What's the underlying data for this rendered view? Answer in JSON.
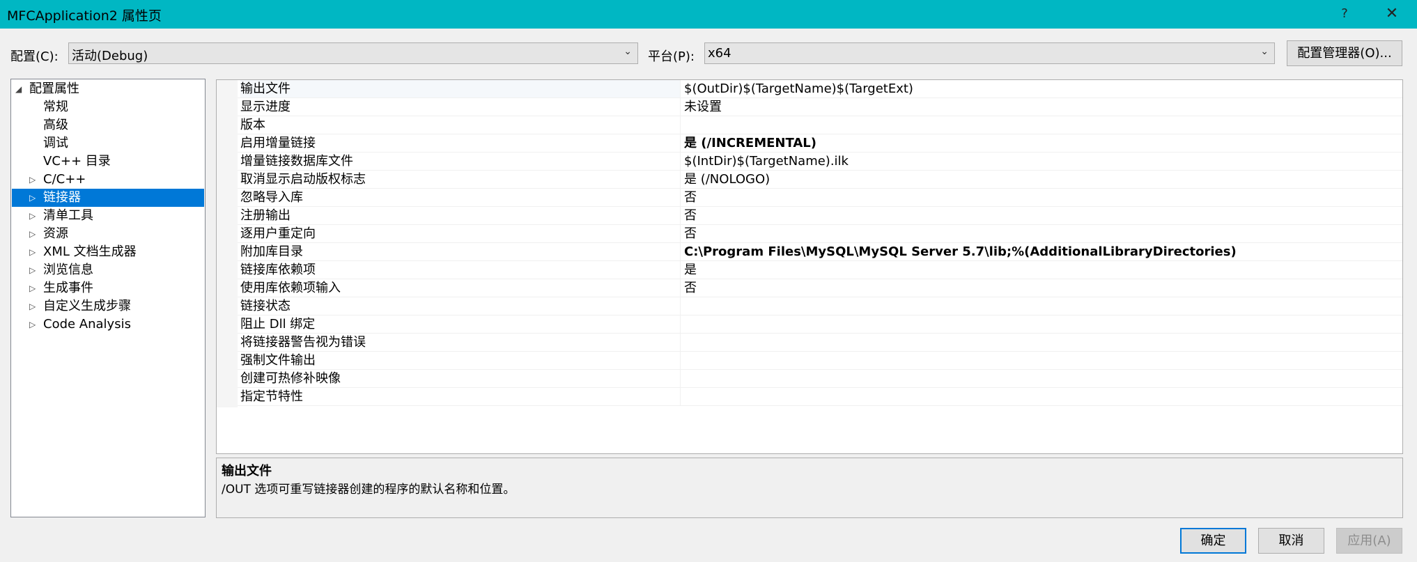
{
  "window": {
    "title": "MFCApplication2 属性页",
    "help_label": "?",
    "close_label": "✕"
  },
  "config_bar": {
    "config_label": "配置(C):",
    "config_value": "活动(Debug)",
    "platform_label": "平台(P):",
    "platform_value": "x64",
    "config_manager_label": "配置管理器(O)..."
  },
  "tree": {
    "items": [
      {
        "label": "配置属性",
        "twisty": "◢"
      },
      {
        "label": "常规",
        "twisty": ""
      },
      {
        "label": "高级",
        "twisty": ""
      },
      {
        "label": "调试",
        "twisty": ""
      },
      {
        "label": "VC++ 目录",
        "twisty": ""
      },
      {
        "label": "C/C++",
        "twisty": "▷"
      },
      {
        "label": "链接器",
        "twisty": "▷"
      },
      {
        "label": "清单工具",
        "twisty": "▷"
      },
      {
        "label": "资源",
        "twisty": "▷"
      },
      {
        "label": "XML 文档生成器",
        "twisty": "▷"
      },
      {
        "label": "浏览信息",
        "twisty": "▷"
      },
      {
        "label": "生成事件",
        "twisty": "▷"
      },
      {
        "label": "自定义生成步骤",
        "twisty": "▷"
      },
      {
        "label": "Code Analysis",
        "twisty": "▷"
      }
    ],
    "selected": "链接器"
  },
  "properties": [
    {
      "name": "输出文件",
      "value": "$(OutDir)$(TargetName)$(TargetExt)"
    },
    {
      "name": "显示进度",
      "value": "未设置"
    },
    {
      "name": "版本",
      "value": ""
    },
    {
      "name": "启用增量链接",
      "value": "是 (/INCREMENTAL)"
    },
    {
      "name": "增量链接数据库文件",
      "value": "$(IntDir)$(TargetName).ilk"
    },
    {
      "name": "取消显示启动版权标志",
      "value": "是 (/NOLOGO)"
    },
    {
      "name": "忽略导入库",
      "value": "否"
    },
    {
      "name": "注册输出",
      "value": "否"
    },
    {
      "name": "逐用户重定向",
      "value": "否"
    },
    {
      "name": "附加库目录",
      "value": "C:\\Program Files\\MySQL\\MySQL Server 5.7\\lib;%(AdditionalLibraryDirectories)"
    },
    {
      "name": "链接库依赖项",
      "value": "是"
    },
    {
      "name": "使用库依赖项输入",
      "value": "否"
    },
    {
      "name": "链接状态",
      "value": ""
    },
    {
      "name": "阻止 Dll 绑定",
      "value": ""
    },
    {
      "name": "将链接器警告视为错误",
      "value": ""
    },
    {
      "name": "强制文件输出",
      "value": ""
    },
    {
      "name": "创建可热修补映像",
      "value": ""
    },
    {
      "name": "指定节特性",
      "value": ""
    }
  ],
  "bold_values": [
    "启用增量链接",
    "附加库目录"
  ],
  "description": {
    "title": "输出文件",
    "text": "/OUT 选项可重写链接器创建的程序的默认名称和位置。"
  },
  "buttons": {
    "ok": "确定",
    "cancel": "取消",
    "apply": "应用(A)"
  },
  "colors": {
    "titlebar": "#00b7c3",
    "selection": "#0078d7"
  }
}
